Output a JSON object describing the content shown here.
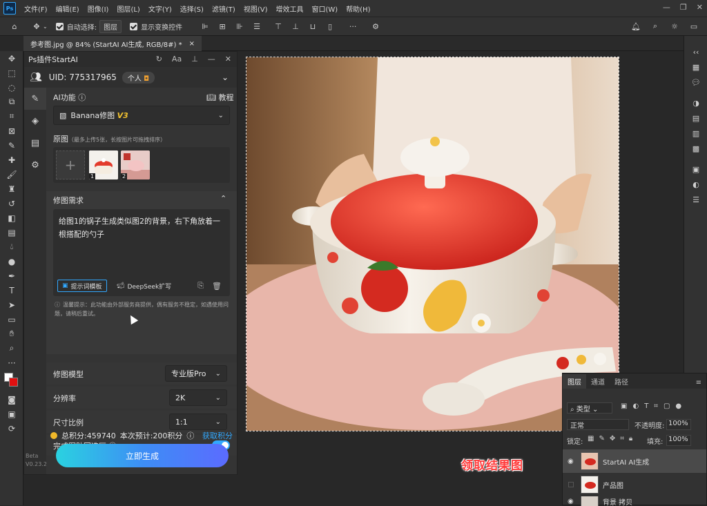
{
  "app": {
    "logo": "Ps"
  },
  "menu": [
    "文件(F)",
    "编辑(E)",
    "图像(I)",
    "图层(L)",
    "文字(Y)",
    "选择(S)",
    "滤镜(T)",
    "视图(V)",
    "增效工具",
    "窗口(W)",
    "帮助(H)"
  ],
  "options": {
    "auto_select_label": "自动选择:",
    "auto_select_value": "图层",
    "show_transform_label": "显示变换控件"
  },
  "document_tab": {
    "title": "参考图.jpg @ 84% (StartAI AI生成, RGB/8#) *",
    "close": "×"
  },
  "plugin": {
    "title": "Ps插件StartAI",
    "uid": "UID: 775317965",
    "account_type": "个人",
    "ai_function_label": "AI功能",
    "tutorial_label": "教程",
    "model_select": "Banana修图",
    "model_version": "V3",
    "source_label": "原图",
    "source_hint": "（最多上传5张，长按图片可拖拽排序）",
    "thumb_numbers": [
      "1",
      "2"
    ],
    "requirement_label": "修图需求",
    "prompt_text": "给图1的锅子生成类似图2的背景，右下角放着一根搭配的勺子",
    "prompt_template_button": "提示词模板",
    "deepseek_button": "DeepSeek扩写",
    "notice": "温馨提示：此功能由外部服务商提供，偶有服务不稳定，如遇使用问题，请稍后重试。",
    "model_label": "修图模型",
    "model_value": "专业版Pro",
    "resolution_label": "分辨率",
    "resolution_value": "2K",
    "ratio_label": "尺寸比例",
    "ratio_value": "1:1",
    "paste_label": "完成图贴回选区",
    "paste_enabled": true,
    "points_label": "总积分:459740",
    "estimate_label": "本次预计:200积分",
    "get_points": "获取积分",
    "generate_button": "立即生成",
    "version": "Beta\nV0.23.2"
  },
  "layers_panel": {
    "tabs": [
      "图层",
      "通道",
      "路径"
    ],
    "filter_label": "类型",
    "blend_mode": "正常",
    "opacity_label": "不透明度:",
    "opacity_value": "100%",
    "lock_label": "锁定:",
    "fill_label": "填充:",
    "fill_value": "100%",
    "layers": [
      {
        "name": "StartAI AI生成",
        "visible": true
      },
      {
        "name": "产品图",
        "visible": false
      },
      {
        "name": "背景 拷贝",
        "visible": true
      }
    ]
  },
  "overlay_caption": "领取结果图",
  "colors": {
    "accent": "#31a8ff",
    "caption": "#ff3b3b",
    "button_start": "#2ad2e0",
    "button_end": "#5b6bff"
  }
}
